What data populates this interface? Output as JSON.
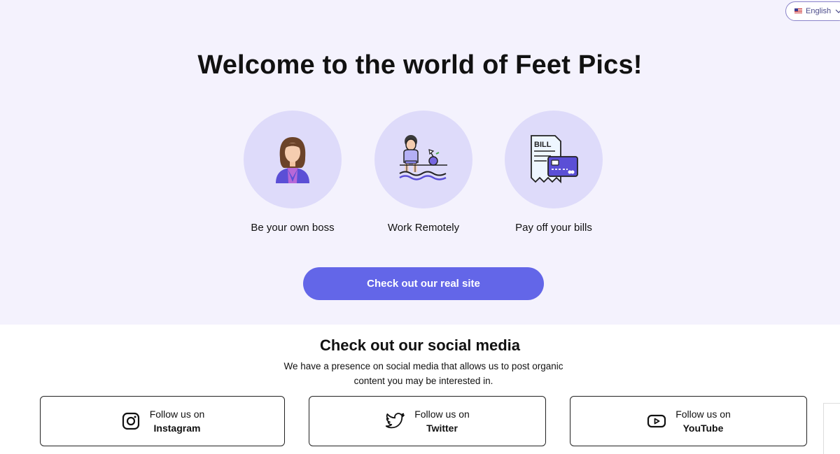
{
  "language": {
    "selected": "English"
  },
  "hero": {
    "title": "Welcome to the world of Feet Pics!",
    "features": [
      {
        "label": "Be your own boss",
        "icon": "businesswoman-icon"
      },
      {
        "label": "Work Remotely",
        "icon": "remote-worker-icon"
      },
      {
        "label": "Pay off your bills",
        "icon": "bill-card-icon"
      }
    ],
    "cta_label": "Check out our real site"
  },
  "social": {
    "title": "Check out our social media",
    "description": "We have a presence on social media that allows us to post organic content you may be interested in.",
    "cards": [
      {
        "prefix": "Follow us on",
        "platform": "Instagram",
        "icon": "instagram-icon"
      },
      {
        "prefix": "Follow us on",
        "platform": "Twitter",
        "icon": "twitter-icon"
      },
      {
        "prefix": "Follow us on",
        "platform": "YouTube",
        "icon": "youtube-icon"
      }
    ]
  },
  "colors": {
    "hero_bg": "#f4f2fd",
    "circle_bg": "#dedbfa",
    "accent": "#6366e8"
  }
}
